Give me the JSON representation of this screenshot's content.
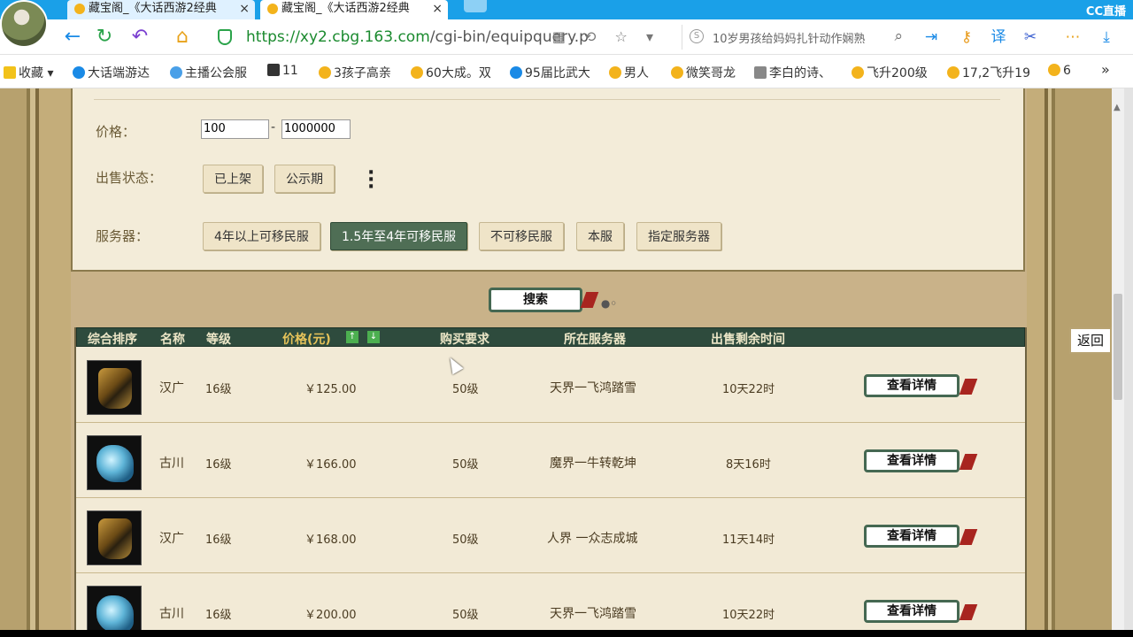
{
  "browser": {
    "tabs": [
      {
        "title": "藏宝阁_《大话西游2经典"
      },
      {
        "title": "藏宝阁_《大话西游2经典"
      }
    ],
    "tab_close": "×",
    "cc_logo": "CC直播",
    "url_host": "https://xy2.cbg.163.com",
    "url_path": "/cgi-bin/equipquery.p",
    "search_text": "10岁男孩给妈妈扎针动作娴熟",
    "bookmarks": [
      "收藏",
      "大话端游达",
      "主播公会服",
      "11",
      "3孩子高亲",
      "60大成。双",
      "95届比武大",
      "男人",
      "微笑哥龙",
      "李白的诗、",
      "飞升200级",
      "17,2飞升19",
      "6"
    ],
    "more": "»"
  },
  "filters": {
    "price_label": "价格：",
    "price_min": "100",
    "price_max": "1000000",
    "price_dash": "-",
    "status_label": "出售状态：",
    "status_options": [
      "已上架",
      "公示期"
    ],
    "server_label": "服务器：",
    "server_options": [
      "4年以上可移民服",
      "1.5年至4年可移民服",
      "不可移民服",
      "本服",
      "指定服务器"
    ],
    "server_selected": "1.5年至4年可移民服"
  },
  "search_button": "搜索",
  "back_button": "返回",
  "table": {
    "headers": [
      "综合排序",
      "名称",
      "等级",
      "价格(元)",
      "购买要求",
      "所在服务器",
      "出售剩余时间"
    ],
    "sort_up": "↑",
    "sort_down": "↓",
    "detail_label": "查看详情",
    "rows": [
      {
        "name": "汉广",
        "level": "16级",
        "price": "￥125.00",
        "req": "50级",
        "server": "天界一飞鸿踏雪",
        "time": "10天22时",
        "icon": "armor-icon"
      },
      {
        "name": "古川",
        "level": "16级",
        "price": "￥166.00",
        "req": "50级",
        "server": "魔界一牛转乾坤",
        "time": "8天16时",
        "icon": "boots-icon"
      },
      {
        "name": "汉广",
        "level": "16级",
        "price": "￥168.00",
        "req": "50级",
        "server": "人界 一众志成城",
        "time": "11天14时",
        "icon": "armor-icon"
      },
      {
        "name": "古川",
        "level": "16级",
        "price": "￥200.00",
        "req": "50级",
        "server": "天界一飞鸿踏雪",
        "time": "10天22时",
        "icon": "boots-icon"
      }
    ]
  },
  "colors": {
    "table_header": "#2e4b3d",
    "selected_button": "#4f6e55",
    "url_green": "#1a8a2e",
    "tab_bar": "#1aa0e8"
  }
}
